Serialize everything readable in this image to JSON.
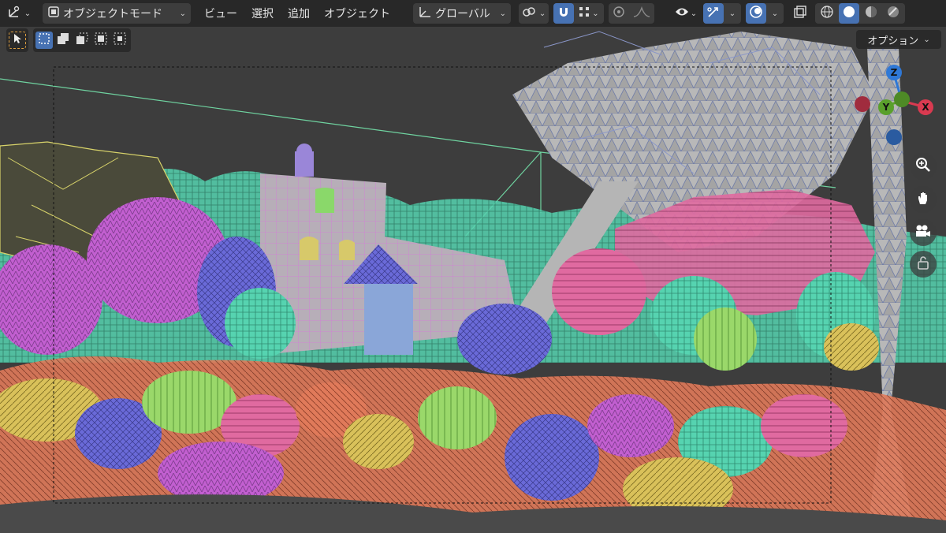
{
  "header": {
    "mode_label": "オブジェクトモード",
    "menus": [
      "ビュー",
      "選択",
      "追加",
      "オブジェクト"
    ],
    "transform_orientation": "グローバル"
  },
  "options": {
    "label": "オプション"
  },
  "gizmo": {
    "axis_z": "Z",
    "axis_y": "Y",
    "axis_x": "X"
  },
  "colors": {
    "accent": "#4772b3",
    "header_bg": "#262626",
    "axis_x": "#d93a50",
    "axis_y": "#5aa02c",
    "axis_z": "#2f78d6"
  },
  "icons": {
    "editor_type": "transform-axes-icon",
    "mode": "object-mode-icon",
    "orientation": "axes-icon",
    "pivot": "link-circles-icon",
    "snap": "magnet-icon",
    "snap_target": "grid-dots-icon",
    "proportional": "circle-dot-icon",
    "falloff": "curve-icon",
    "visibility": "eye-icon",
    "gizmo_toggle": "arrow-gizmo-icon",
    "overlays": "overlay-circles-icon",
    "xray": "xray-icon",
    "shading": [
      "wireframe-icon",
      "solid-icon",
      "material-icon",
      "rendered-icon"
    ],
    "tools": [
      "select-cursor-icon",
      "select-new-icon",
      "select-extend-icon",
      "select-subtract-icon",
      "select-invert-icon",
      "select-intersect-icon"
    ],
    "nav": [
      "zoom-icon",
      "hand-pan-icon",
      "camera-icon",
      "lock-icon"
    ]
  }
}
